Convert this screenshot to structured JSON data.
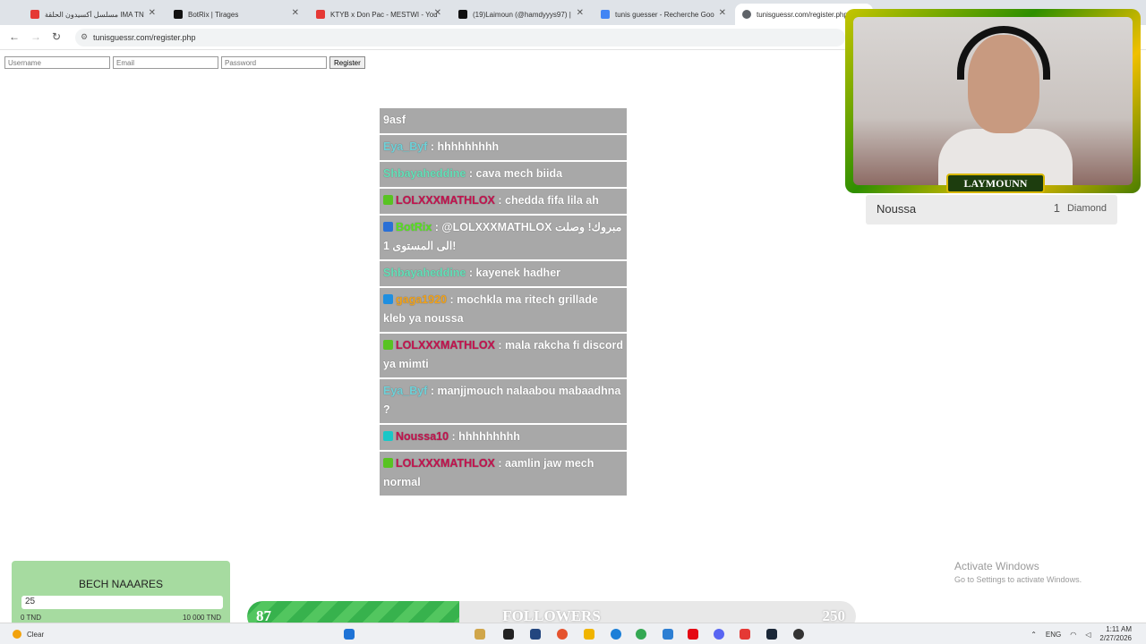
{
  "browser": {
    "tabs": [
      {
        "title": "مسلسل أكسيدون الحلقة IMA TN",
        "color": "#e53935"
      },
      {
        "title": "BotRix | Tirages",
        "color": "#111111"
      },
      {
        "title": "KTYB x Don Pac - MESTWI - You",
        "color": "#e53935"
      },
      {
        "title": "(19)Laimoun (@hamdyyys97) |",
        "color": "#111111"
      },
      {
        "title": "tunis guesser - Recherche Goo",
        "color": "#4285f4"
      },
      {
        "title": "tunisguessr.com/register.php",
        "color": "#5f6368"
      }
    ],
    "url": "tunisguessr.com/register.php"
  },
  "form": {
    "username_placeholder": "Username",
    "email_placeholder": "Email",
    "password_placeholder": "Password",
    "register_label": "Register"
  },
  "chat": {
    "messages": [
      {
        "user": "",
        "user_color": "#ffffff",
        "text": "9asf"
      },
      {
        "user": "Eya_Byf",
        "user_color": "#6fd1d8",
        "text": ": hhhhhhhhh"
      },
      {
        "user": "Shbayaheddine",
        "user_color": "#63e0b8",
        "text": ": cava mech biida"
      },
      {
        "user": "LOLXXXMATHLOX",
        "user_color": "#c4124e",
        "text": ": chedda fifa lila ah",
        "badge": "#58c322"
      },
      {
        "user": "BotRix",
        "user_color": "#56e31e",
        "text": ": @LOLXXXMATHLOX مبروك! وصلت الى المستوى 1!",
        "badge": "#2a6fd6"
      },
      {
        "user": "Shbayaheddine",
        "user_color": "#63e0b8",
        "text": ": kayenek hadher"
      },
      {
        "user": "gaga1920",
        "user_color": "#f2a31b",
        "text": ": mochkla ma ritech grillade kleb ya noussa",
        "badge": "#1f8fe0"
      },
      {
        "user": "LOLXXXMATHLOX",
        "user_color": "#c4124e",
        "text": ": mala rakcha fi discord ya mimti",
        "badge": "#58c322"
      },
      {
        "user": "Eya_Byf",
        "user_color": "#6fd1d8",
        "text": ": manjjmouch nalaabou mabaadhna ?"
      },
      {
        "user": "Noussa10",
        "user_color": "#c4124e",
        "text": ": hhhhhhhhh",
        "badge": "#19c7c7"
      },
      {
        "user": "LOLXXXMATHLOX",
        "user_color": "#c4124e",
        "text": ": aamlin jaw mech normal",
        "badge": "#58c322"
      }
    ]
  },
  "webcam": {
    "label": "LAYMOUNN"
  },
  "leaderboard": {
    "name": "Noussa",
    "count": "1",
    "unit": "Diamond"
  },
  "goal": {
    "title": "BECH NAAARES",
    "value": "25",
    "min": "0 TND",
    "max": "10 000 TND",
    "progress": 0.0025
  },
  "followers": {
    "current": "87",
    "label": "FOLLOWERS",
    "target": "250",
    "progress": 0.348
  },
  "watermark": {
    "line1": "Activate Windows",
    "line2": "Go to Settings to activate Windows."
  },
  "taskbar": {
    "weather": "Clear",
    "lang": "ENG",
    "time": "1:11 AM",
    "date": "2/27/2026"
  }
}
